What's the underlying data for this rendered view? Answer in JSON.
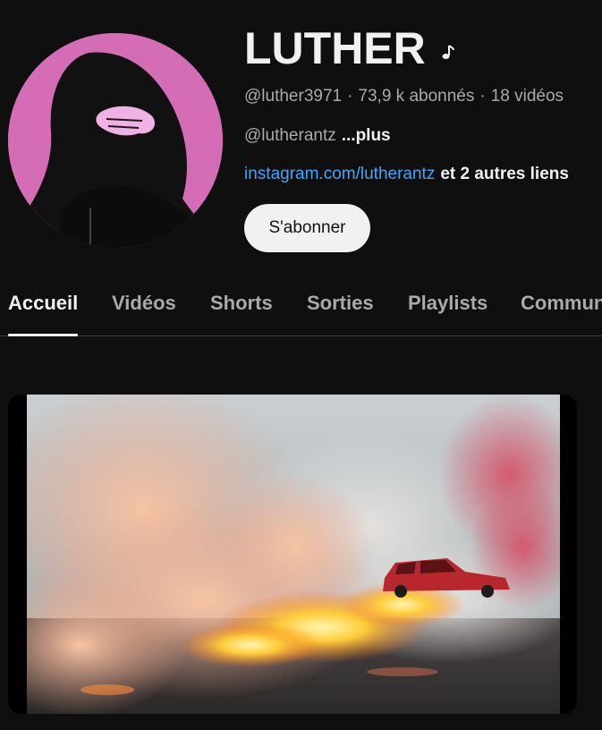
{
  "channel": {
    "name": "LUTHER",
    "name_badge_icon": "music-note-icon",
    "handle": "@luther3971",
    "subscribers": "73,9 k abonnés",
    "videos": "18 vidéos",
    "separator": "·",
    "description": "@lutherantz",
    "more_label": "...plus",
    "link_text": "instagram.com/lutherantz",
    "other_links": "et 2 autres liens",
    "subscribe_label": "S'abonner"
  },
  "tabs": [
    {
      "label": "Accueil",
      "active": true
    },
    {
      "label": "Vidéos",
      "active": false
    },
    {
      "label": "Shorts",
      "active": false
    },
    {
      "label": "Sorties",
      "active": false
    },
    {
      "label": "Playlists",
      "active": false
    },
    {
      "label": "Communauté",
      "active": false
    }
  ],
  "featured_video": {
    "thumbnail": "smoke-and-fire-burnout-car"
  },
  "colors": {
    "background": "#0f0f0f",
    "text_primary": "#f1f1f1",
    "text_secondary": "#aaaaaa",
    "link": "#3ea6ff",
    "avatar_bg": "#d46cb6"
  }
}
